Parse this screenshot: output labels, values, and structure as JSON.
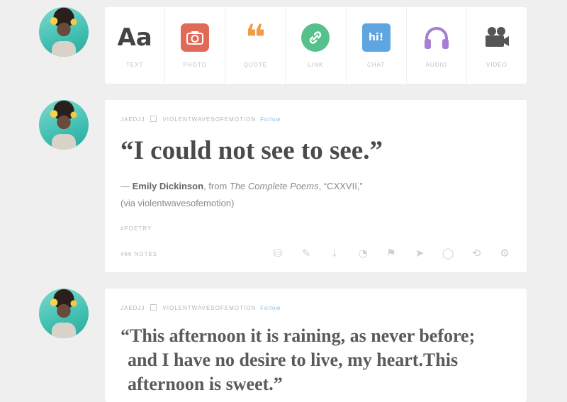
{
  "composer": {
    "items": [
      {
        "label": "TEXT",
        "glyph": "Aa",
        "icon": "text-icon"
      },
      {
        "label": "PHOTO",
        "glyph": "",
        "icon": "camera-icon"
      },
      {
        "label": "QUOTE",
        "glyph": "❝",
        "icon": "quote-icon"
      },
      {
        "label": "LINK",
        "glyph": "",
        "icon": "link-icon"
      },
      {
        "label": "CHAT",
        "glyph": "hi!",
        "icon": "chat-icon"
      },
      {
        "label": "AUDIO",
        "glyph": "",
        "icon": "headphones-icon"
      },
      {
        "label": "VIDEO",
        "glyph": "",
        "icon": "video-camera-icon"
      }
    ]
  },
  "posts": [
    {
      "reblogger": "JAEDJJ",
      "author": "VIOLENTWAVESOFEMOTION",
      "follow": "Follow",
      "quote": "“I could not see to see.”",
      "source_dash": "—",
      "source_name": "Emily Dickinson",
      "source_from": ", from ",
      "source_work": "The Complete Poems",
      "source_poem": ", “CXXVII,”",
      "source_via": "(via violentwavesofemotion)",
      "tag": "#POETRY",
      "notes": "466 NOTES"
    },
    {
      "reblogger": "JAEDJJ",
      "author": "VIOLENTWAVESOFEMOTION",
      "follow": "Follow",
      "quote_line1": "“This afternoon it is raining, as never before;",
      "quote_line2": "and I have no desire to live, my heart.This",
      "quote_line3": "afternoon is sweet.”"
    }
  ],
  "colors": {
    "background": "#efefef",
    "photo": "#e06a55",
    "quote": "#f29b46",
    "link": "#56c18b",
    "chat": "#5fa6e0",
    "audio": "#a77dd6",
    "video": "#555555"
  }
}
